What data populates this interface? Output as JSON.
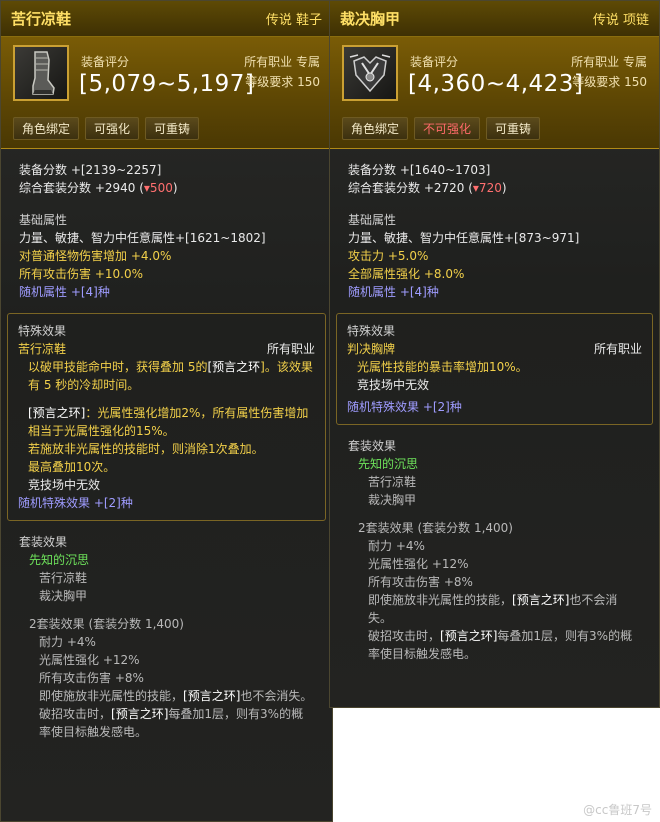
{
  "left": {
    "name": "苦行凉鞋",
    "tag": "传说 鞋子",
    "score_label": "装备评分",
    "score": "[5,079~5,197]",
    "job": "所有职业 专属",
    "level": "等级要求 150",
    "buttons": [
      "角色绑定",
      "可强化",
      "可重铸"
    ],
    "equip_score": "装备分数 +[2139~2257]",
    "set_score_prefix": "综合套装分数 +2940 (",
    "set_score_delta": "▾500",
    "set_score_suffix": ")",
    "base_title": "基础属性",
    "base_lines": [
      {
        "text": "力量、敏捷、智力中任意属性+[1621~1802]",
        "color": "w"
      },
      {
        "text": "对普通怪物伤害增加 +4.0%",
        "color": "y"
      },
      {
        "text": "所有攻击伤害 +10.0%",
        "color": "y"
      },
      {
        "text": "随机属性 +[4]种",
        "color": "b"
      }
    ],
    "special_title": "特殊效果",
    "special_name": "苦行凉鞋",
    "special_job": "所有职业",
    "special_text1a": "以破甲技能命中时，获得叠加 5的",
    "special_text1b": "[预言之环",
    "special_text1c": "]。该效果有 5 秒的冷却时间。",
    "special_text2a": "[预言之环]",
    "special_text2b": "：光属性强化增加2%，所有属性伤害增加相当于光属性强化的15%。",
    "special_text3": "若施放非光属性的技能时，则消除1次叠加。",
    "special_text4": "最高叠加10次。",
    "special_text5": "竞技场中无效",
    "special_random": "随机特殊效果 +[2]种",
    "set_title": "套装效果",
    "set_name": "先知的沉思",
    "set_items": [
      "苦行凉鞋",
      "裁决胸甲"
    ],
    "set2_title": "2套装效果 (套装分数 1,400)",
    "set2_lines": [
      "耐力 +4%",
      "光属性强化 +12%",
      "所有攻击伤害 +8%"
    ],
    "set2_line4a": "即使施放非光属性的技能，",
    "set2_line4b": "[预言之环]",
    "set2_line4c": "也不会消失。",
    "set2_line5a": "破招攻击时，",
    "set2_line5b": "[预言之环]",
    "set2_line5c": "每叠加1层，则有3%的概率使目标触发感电。"
  },
  "right": {
    "name": "裁决胸甲",
    "tag": "传说 项链",
    "score_label": "装备评分",
    "score": "[4,360~4,423]",
    "job": "所有职业 专属",
    "level": "等级要求 150",
    "buttons": [
      "角色绑定",
      "不可强化",
      "可重铸"
    ],
    "equip_score": "装备分数 +[1640~1703]",
    "set_score_prefix": "综合套装分数 +2720 (",
    "set_score_delta": "▾720",
    "set_score_suffix": ")",
    "base_title": "基础属性",
    "base_lines": [
      {
        "text": "力量、敏捷、智力中任意属性+[873~971]",
        "color": "w"
      },
      {
        "text": "攻击力 +5.0%",
        "color": "y"
      },
      {
        "text": "全部属性强化 +8.0%",
        "color": "y"
      },
      {
        "text": "随机属性 +[4]种",
        "color": "b"
      }
    ],
    "special_title": "特殊效果",
    "special_name": "判决胸牌",
    "special_job": "所有职业",
    "special_text1": "光属性技能的暴击率增加10%。",
    "special_text2": "竞技场中无效",
    "special_random": "随机特殊效果 +[2]种",
    "set_title": "套装效果",
    "set_name": "先知的沉思",
    "set_items": [
      "苦行凉鞋",
      "裁决胸甲"
    ],
    "set2_title": "2套装效果 (套装分数 1,400)",
    "set2_lines": [
      "耐力 +4%",
      "光属性强化 +12%",
      "所有攻击伤害 +8%"
    ],
    "set2_line4a": "即使施放非光属性的技能，",
    "set2_line4b": "[预言之环]",
    "set2_line4c": "也不会消失。",
    "set2_line5a": "破招攻击时，",
    "set2_line5b": "[预言之环]",
    "set2_line5c": "每叠加1层，则有3%的概率使目标触发感电。"
  },
  "watermark": "@cc鲁班7号"
}
